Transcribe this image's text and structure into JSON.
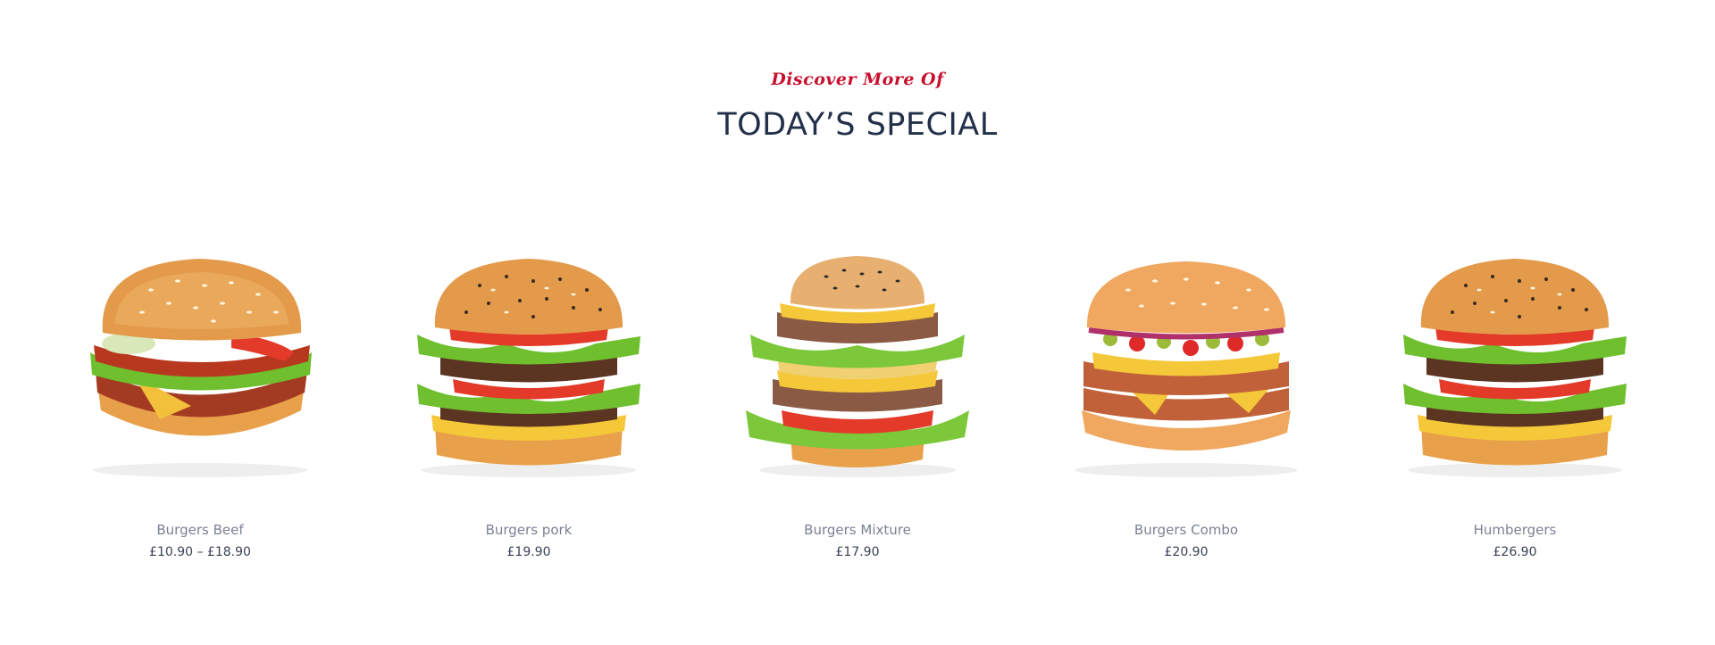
{
  "section": {
    "kicker": "Discover More Of",
    "title": "TODAY’S SPECIAL"
  },
  "products": [
    {
      "name": "Burgers Beef",
      "price": "£10.90 – £18.90",
      "image_icon": "beef-burger-image"
    },
    {
      "name": "Burgers pork",
      "price": "£19.90",
      "image_icon": "pork-burger-image"
    },
    {
      "name": "Burgers Mixture",
      "price": "£17.90",
      "image_icon": "mixture-burger-image"
    },
    {
      "name": "Burgers Combo",
      "price": "£20.90",
      "image_icon": "combo-burger-image"
    },
    {
      "name": "Humbergers",
      "price": "£26.90",
      "image_icon": "hamburger-image"
    }
  ],
  "colors": {
    "kicker": "#c8102e",
    "title": "#23304a",
    "product_name": "#7a8194",
    "product_price": "#3a4257"
  }
}
